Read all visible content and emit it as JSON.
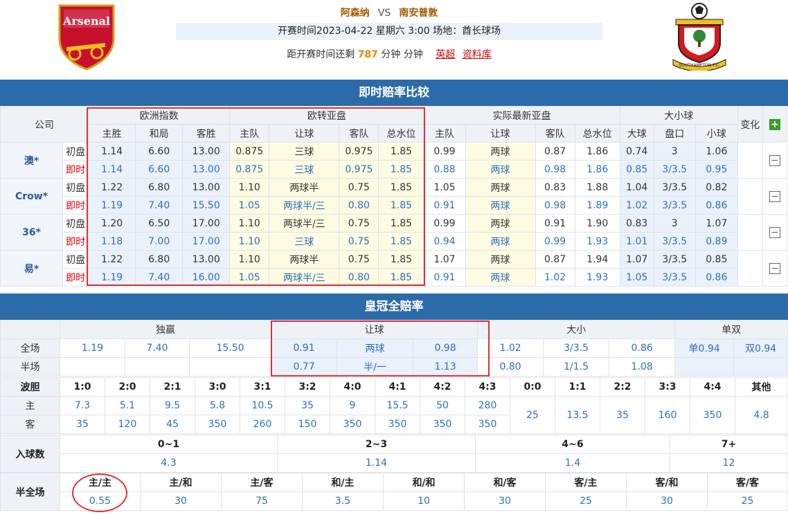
{
  "header": {
    "home": "阿森纳",
    "vs": "VS",
    "away": "南安普敦",
    "info": "开赛时间2023-04-22 星期六 3:00  场地：酋长球场",
    "countdown_pre": "距开赛时间还剩",
    "countdown_num": "787",
    "countdown_post": "分钟 分钟",
    "link1": "英超",
    "link2": "资料库",
    "home_crest": "Arsenal",
    "away_crest": "SOUTHAMPTON F.C."
  },
  "odds_section": {
    "title": "即时赔率比较",
    "company_header": "公司",
    "groups": [
      "欧洲指数",
      "欧转亚盘",
      "实际最新亚盘",
      "大小球"
    ],
    "change_header": "变化",
    "plus": "+",
    "subheaders": [
      "主胜",
      "和局",
      "客胜",
      "主队",
      "让球",
      "客队",
      "总水位",
      "主队",
      "让球",
      "客队",
      "总水位",
      "大球",
      "盘口",
      "小球"
    ],
    "rows": [
      {
        "company": "澳*",
        "lines": [
          {
            "type": "初盘",
            "v": [
              "1.14",
              "6.60",
              "13.00",
              "0.875",
              "三球",
              "0.975",
              "1.85",
              "0.99",
              "两球",
              "0.87",
              "1.86",
              "0.74",
              "3",
              "1.06"
            ]
          },
          {
            "type": "即时",
            "v": [
              "1.14",
              "6.60",
              "13.00",
              "0.875",
              "三球",
              "0.975",
              "1.85",
              "0.88",
              "两球",
              "0.98",
              "1.86",
              "0.85",
              "3/3.5",
              "0.95"
            ]
          }
        ]
      },
      {
        "company": "Crow*",
        "lines": [
          {
            "type": "初盘",
            "v": [
              "1.22",
              "6.80",
              "13.00",
              "1.10",
              "两球半",
              "0.75",
              "1.85",
              "1.05",
              "两球",
              "0.83",
              "1.88",
              "1.04",
              "3/3.5",
              "0.82"
            ]
          },
          {
            "type": "即时",
            "v": [
              "1.19",
              "7.40",
              "15.50",
              "1.05",
              "两球半/三",
              "0.80",
              "1.85",
              "0.91",
              "两球",
              "0.98",
              "1.89",
              "1.02",
              "3/3.5",
              "0.86"
            ]
          }
        ]
      },
      {
        "company": "36*",
        "lines": [
          {
            "type": "初盘",
            "v": [
              "1.20",
              "6.50",
              "17.00",
              "1.10",
              "两球半/三",
              "0.75",
              "1.85",
              "0.99",
              "两球",
              "0.91",
              "1.90",
              "0.83",
              "3",
              "1.07"
            ]
          },
          {
            "type": "即时",
            "v": [
              "1.18",
              "7.00",
              "17.00",
              "1.10",
              "三球",
              "0.75",
              "1.85",
              "0.94",
              "两球",
              "0.99",
              "1.93",
              "1.01",
              "3/3.5",
              "0.89"
            ]
          }
        ]
      },
      {
        "company": "易*",
        "lines": [
          {
            "type": "初盘",
            "v": [
              "1.22",
              "6.80",
              "13.00",
              "1.10",
              "两球半",
              "0.75",
              "1.85",
              "1.07",
              "两球",
              "0.87",
              "1.94",
              "1.07",
              "3/3.5",
              "0.85"
            ]
          },
          {
            "type": "即时",
            "v": [
              "1.19",
              "7.40",
              "16.00",
              "1.05",
              "两球半/三",
              "0.80",
              "1.85",
              "0.91",
              "两球",
              "1.02",
              "1.93",
              "1.05",
              "3/3.5",
              "0.86"
            ]
          }
        ]
      }
    ],
    "collapse": "−"
  },
  "crown_section": {
    "title": "皇冠全赔率",
    "groups": [
      "独赢",
      "让球",
      "大小",
      "单双"
    ],
    "full_label": "全场",
    "half_label": "半场",
    "full": [
      "1.19",
      "7.40",
      "15.50",
      "0.91",
      "两球",
      "0.98",
      "1.02",
      "3/3.5",
      "0.86",
      "单0.94",
      "双0.94"
    ],
    "half": [
      "",
      "",
      "",
      "0.77",
      "半/一",
      "1.13",
      "0.80",
      "1/1.5",
      "1.08",
      "",
      ""
    ],
    "score_label": "波胆",
    "home_label": "主",
    "away_label": "客",
    "scores": [
      "1:0",
      "2:0",
      "2:1",
      "3:0",
      "3:1",
      "3:2",
      "4:0",
      "4:1",
      "4:2",
      "4:3"
    ],
    "home_vals": [
      "7.3",
      "5.1",
      "9.5",
      "5.8",
      "10.5",
      "35",
      "9",
      "15.5",
      "50",
      "280"
    ],
    "away_vals": [
      "35",
      "120",
      "45",
      "350",
      "260",
      "150",
      "350",
      "350",
      "350",
      "350"
    ],
    "draw_scores": [
      "0:0",
      "1:1",
      "2:2",
      "3:3",
      "4:4",
      "其他"
    ],
    "draw_vals": [
      "25",
      "13.5",
      "35",
      "160",
      "350",
      "4.8"
    ],
    "goals_label": "入球数",
    "goals": [
      "0~1",
      "2~3",
      "4~6",
      "7+"
    ],
    "goals_vals": [
      "4.3",
      "1.14",
      "1.4",
      "12"
    ],
    "htft_label": "半全场",
    "htft": [
      "主/主",
      "主/和",
      "主/客",
      "和/主",
      "和/和",
      "和/客",
      "客/主",
      "客/和",
      "客/客"
    ],
    "htft_vals": [
      "0.55",
      "30",
      "75",
      "3.5",
      "10",
      "30",
      "25",
      "30",
      "25"
    ]
  }
}
